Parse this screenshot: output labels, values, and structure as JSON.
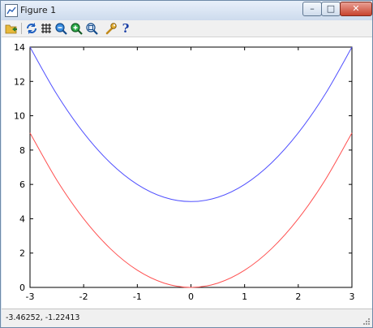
{
  "window": {
    "title": "Figure 1",
    "controls": {
      "minimize": "–",
      "maximize": "□",
      "close": "✕"
    }
  },
  "toolbar": {
    "icons": [
      "open-folder-icon",
      "refresh-icon",
      "grid-icon",
      "zoom-in-icon",
      "zoom-out-icon",
      "zoom-reset-icon",
      "wrench-icon",
      "help-icon"
    ],
    "help_glyph": "?"
  },
  "status": {
    "coordinates": "-3.46252, -1.22413"
  },
  "chart_data": {
    "type": "line",
    "title": "",
    "xlabel": "",
    "ylabel": "",
    "xlim": [
      -3,
      3
    ],
    "ylim": [
      0,
      14
    ],
    "xticks": [
      -3,
      -2,
      -1,
      0,
      1,
      2,
      3
    ],
    "yticks": [
      0,
      2,
      4,
      6,
      8,
      10,
      12,
      14
    ],
    "grid": false,
    "series": [
      {
        "color": "#5050ff",
        "x": [
          -3,
          -2.5,
          -2,
          -1.5,
          -1,
          -0.5,
          0,
          0.5,
          1,
          1.5,
          2,
          2.5,
          3
        ],
        "y": [
          14,
          11.25,
          9,
          7.25,
          6,
          5.25,
          5,
          5.25,
          6,
          7.25,
          9,
          11.25,
          14
        ]
      },
      {
        "color": "#ff5050",
        "x": [
          -3,
          -2.5,
          -2,
          -1.5,
          -1,
          -0.5,
          0,
          0.5,
          1,
          1.5,
          2,
          2.5,
          3
        ],
        "y": [
          9,
          6.25,
          4,
          2.25,
          1,
          0.25,
          0,
          0.25,
          1,
          2.25,
          4,
          6.25,
          9
        ]
      }
    ]
  }
}
